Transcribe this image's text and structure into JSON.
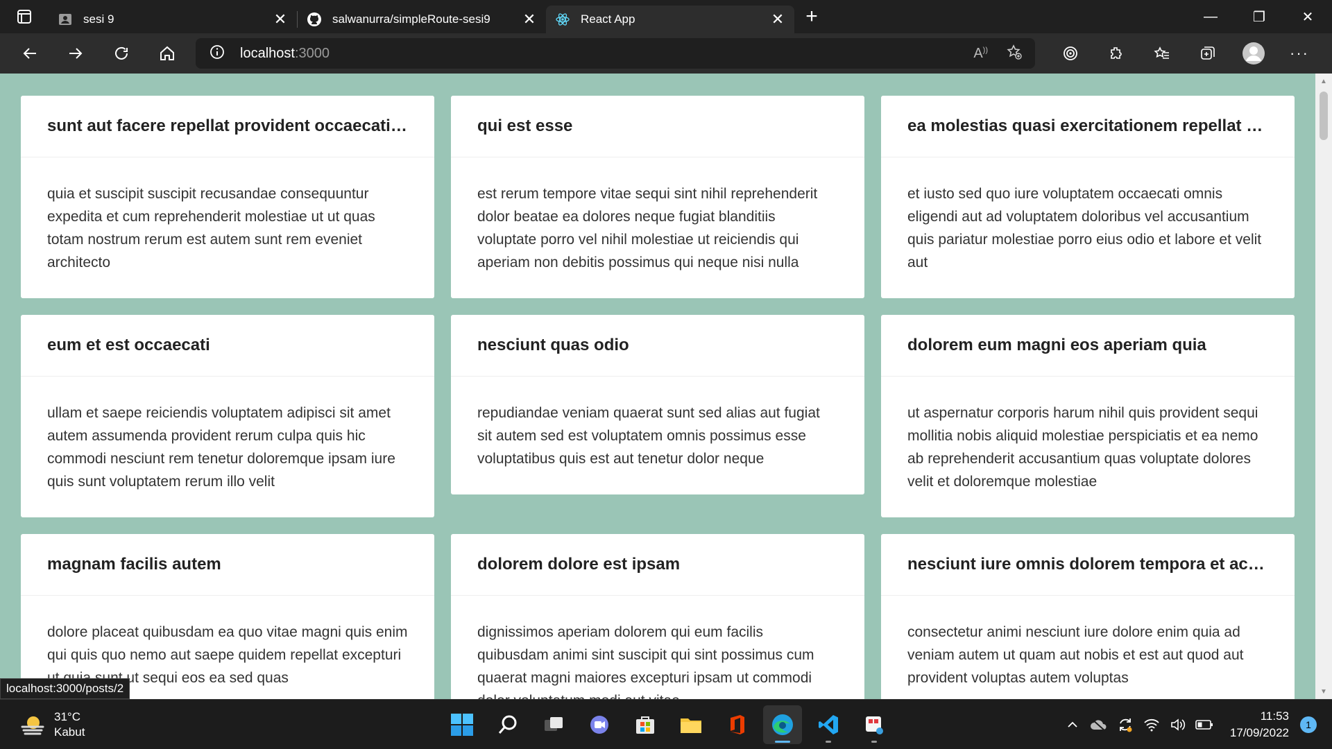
{
  "browser": {
    "tabs": [
      {
        "title": "sesi 9",
        "icon": "profile-icon",
        "active": false
      },
      {
        "title": "salwanurra/simpleRoute-sesi9",
        "icon": "github-icon",
        "active": false
      },
      {
        "title": "React App",
        "icon": "react-icon",
        "active": true
      }
    ],
    "address": {
      "host": "localhost",
      "port": ":3000"
    }
  },
  "posts": [
    {
      "title": "sunt aut facere repellat provident occaecati e...",
      "body": "quia et suscipit suscipit recusandae consequuntur expedita et cum reprehenderit molestiae ut ut quas totam nostrum rerum est autem sunt rem eveniet architecto"
    },
    {
      "title": "qui est esse",
      "body": "est rerum tempore vitae sequi sint nihil reprehenderit dolor beatae ea dolores neque fugiat blanditiis voluptate porro vel nihil molestiae ut reiciendis qui aperiam non debitis possimus qui neque nisi nulla"
    },
    {
      "title": "ea molestias quasi exercitationem repellat qui...",
      "body": "et iusto sed quo iure voluptatem occaecati omnis eligendi aut ad voluptatem doloribus vel accusantium quis pariatur molestiae porro eius odio et labore et velit aut"
    },
    {
      "title": "eum et est occaecati",
      "body": "ullam et saepe reiciendis voluptatem adipisci sit amet autem assumenda provident rerum culpa quis hic commodi nesciunt rem tenetur doloremque ipsam iure quis sunt voluptatem rerum illo velit"
    },
    {
      "title": "nesciunt quas odio",
      "body": "repudiandae veniam quaerat sunt sed alias aut fugiat sit autem sed est voluptatem omnis possimus esse voluptatibus quis est aut tenetur dolor neque"
    },
    {
      "title": "dolorem eum magni eos aperiam quia",
      "body": "ut aspernatur corporis harum nihil quis provident sequi mollitia nobis aliquid molestiae perspiciatis et ea nemo ab reprehenderit accusantium quas voluptate dolores velit et doloremque molestiae"
    },
    {
      "title": "magnam facilis autem",
      "body": "dolore placeat quibusdam ea quo vitae magni quis enim qui quis quo nemo aut saepe quidem repellat excepturi ut quia sunt ut sequi eos ea sed quas"
    },
    {
      "title": "dolorem dolore est ipsam",
      "body": "dignissimos aperiam dolorem qui eum facilis quibusdam animi sint suscipit qui sint possimus cum quaerat magni maiores excepturi ipsam ut commodi dolor voluptatum modi aut vitae"
    },
    {
      "title": "nesciunt iure omnis dolorem tempora et accu...",
      "body": "consectetur animi nesciunt iure dolore enim quia ad veniam autem ut quam aut nobis et est aut quod aut provident voluptas autem voluptas"
    }
  ],
  "status_url": "localhost:3000/posts/2",
  "taskbar": {
    "weather": {
      "temp": "31°C",
      "condition": "Kabut"
    },
    "time": "11:53",
    "date": "17/09/2022",
    "notifications": "1"
  },
  "colors": {
    "page_bg": "#9ac5b6",
    "card_bg": "#ffffff",
    "chrome_bg": "#202020",
    "accent": "#5fb8f5"
  }
}
